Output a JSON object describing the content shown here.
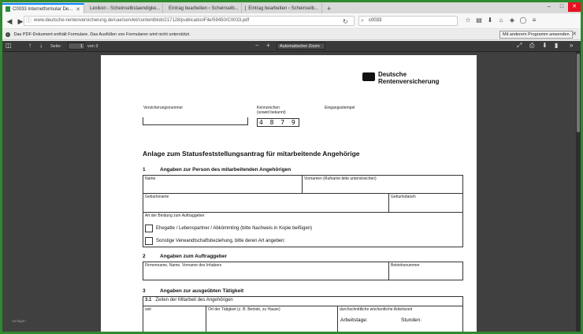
{
  "browser": {
    "tabs": [
      {
        "label": "C0033 Internetformular De...",
        "active": true,
        "favicon_color": "#2a8c3c"
      },
      {
        "label": "Lexikon - Scheinselbstaendigke...",
        "active": false,
        "favicon_color": "#5b8fd0"
      },
      {
        "label": "Eintrag bearbeiten ‹ Scheinselb...",
        "active": false,
        "favicon_color": "#888888"
      },
      {
        "label": "Eintrag bearbeiten ‹ Scheinselb...",
        "active": false,
        "favicon_color": "#888888"
      }
    ],
    "new_tab": "+",
    "url": "www.deutsche-rentenversicherung.de/cae/servlet/contentblob/217128/publicationFile/59450/C0033.pdf",
    "search_value": "c0033",
    "window_buttons": [
      "–",
      "□",
      "✕"
    ]
  },
  "notification": {
    "text": "Das PDF-Dokument enthält Formulare. Das Ausfüllen von Formularen wird nicht unterstützt.",
    "button": "Mit anderem Programm anwenden"
  },
  "pdf_toolbar": {
    "page_label": "Seite:",
    "page_value": "1",
    "page_total": "von 3",
    "zoom": "Automatischer Zoom"
  },
  "viewer": {
    "hint": "Vorlagen"
  },
  "document": {
    "logo_line1": "Deutsche",
    "logo_line2": "Rentenversicherung",
    "versicherungsnummer_label": "Versicherungsnummer",
    "kennzeichen_label": "Kennzeichen",
    "kennzeichen_sub": "(soweit bekannt)",
    "kennzeichen_value": "4 8 7 9",
    "eingangsstempel_label": "Eingangsstempel",
    "title": "Anlage zum Statusfeststellungsantrag für mitarbeitende Angehörige",
    "s1": {
      "num": "1",
      "title": "Angaben zur Person des mitarbeitenden Angehörigen",
      "name": "Name",
      "vornamen": "Vornamen (Rufname bitte unterstreichen)",
      "geburtsname": "Geburtsname",
      "geburtsdatum": "Geburtsdatum",
      "bindung": "Art der Bindung zum Auftraggeber",
      "opt1": "Ehegatte / Lebenspartner / Abkömmling (bitte Nachweis in Kopie beifügen)",
      "opt2": "Sonstige Verwandtschaftsbeziehung, bitte deren Art angeben:"
    },
    "s2": {
      "num": "2",
      "title": "Angaben zum Auftraggeber",
      "firmenname": "Firmenname, Name, Vorname des Inhabers",
      "betriebsnummer": "Betriebsnummer"
    },
    "s3": {
      "num": "3",
      "title": "Angaben zur ausgeübten Tätigkeit",
      "sub_num": "3.1",
      "sub_title": "Zeiten der Mitarbeit des Angehörigen",
      "seit": "seit",
      "ort": "Ort der Tätigkeit (z. B. Betrieb, zu Hause)",
      "arbeitszeit": "durchschnittliche wöchentliche Arbeitszeit",
      "arbeitstage": "Arbeitstage:",
      "stunden": "Stunden:"
    }
  }
}
